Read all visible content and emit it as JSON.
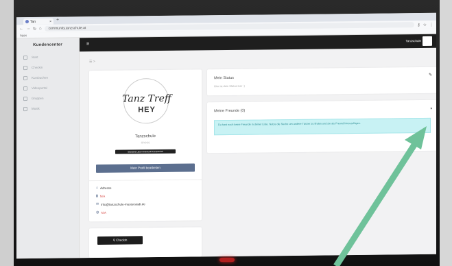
{
  "browser": {
    "tab_title": "Tan",
    "url": "community.tanzschule.at",
    "bookmarks_label": "Apps"
  },
  "sidebar": {
    "title": "Kundencenter",
    "items": [
      {
        "label": "Start",
        "icon": "home-icon"
      },
      {
        "label": "Checkin",
        "icon": "pin-icon"
      },
      {
        "label": "Kursbuchen",
        "icon": "calendar-icon"
      },
      {
        "label": "Videoportal",
        "icon": "video-icon"
      },
      {
        "label": "Gruppen",
        "icon": "group-icon"
      },
      {
        "label": "Musik",
        "icon": "music-icon"
      }
    ]
  },
  "topbar": {
    "menu_glyph": "≡",
    "brand": "Tanzschule"
  },
  "breadcrumb": "☰ >",
  "profile": {
    "logo_script": "Tanz Treff",
    "logo_word": "HEY",
    "name": "Tanzschule",
    "subtitle": "GROSS",
    "badge": "Standard Label Unterkunft Kursbereich",
    "edit_button": "Mein Profil bearbeiten",
    "info": [
      {
        "icon": "home-icon",
        "text": "Adresse",
        "color": "#333"
      },
      {
        "icon": "phone-icon",
        "text": "N/A",
        "color": "#d9534f"
      },
      {
        "icon": "mail-icon",
        "text": "info@tanzschule-musterstadt.de",
        "color": "#333"
      },
      {
        "icon": "globe-icon",
        "text": "N/A",
        "color": "#d9534f"
      }
    ]
  },
  "status": {
    "title": "Mein Status",
    "subtitle": "Hier ist dein Status leer :)",
    "edit_glyph": "✎"
  },
  "friends": {
    "title": "Meine Freunde (0)",
    "caret_glyph": "▾",
    "alert": "Du hast noch keine Freunde in deiner Liste. Nutze die Suche um andere Tänzer zu finden und sie als Freund hinzuzufügen."
  },
  "checkin": {
    "label": "Checkin"
  },
  "colors": {
    "accent": "#5c6f8f",
    "arrow": "#6fc29a",
    "alert_bg": "#c8f2f4"
  }
}
